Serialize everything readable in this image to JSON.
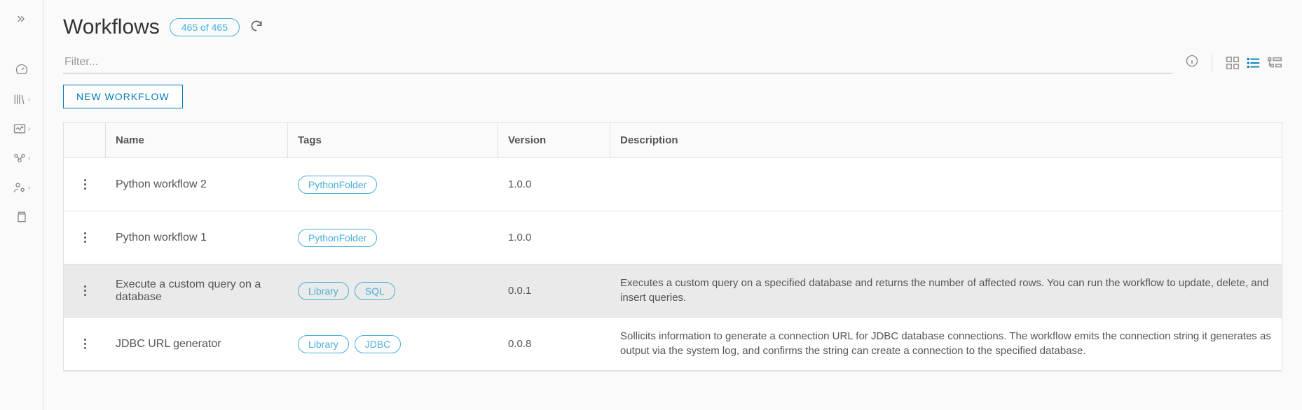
{
  "header": {
    "title": "Workflows",
    "count_badge": "465 of 465"
  },
  "filter": {
    "placeholder": "Filter..."
  },
  "actions": {
    "new_workflow_label": "NEW WORKFLOW"
  },
  "table": {
    "columns": {
      "name": "Name",
      "tags": "Tags",
      "version": "Version",
      "description": "Description"
    },
    "rows": [
      {
        "name": "Python workflow 2",
        "tags": [
          "PythonFolder"
        ],
        "version": "1.0.0",
        "description": "",
        "selected": false
      },
      {
        "name": "Python workflow 1",
        "tags": [
          "PythonFolder"
        ],
        "version": "1.0.0",
        "description": "",
        "selected": false
      },
      {
        "name": "Execute a custom query on a database",
        "tags": [
          "Library",
          "SQL"
        ],
        "version": "0.0.1",
        "description": "Executes a custom query on a specified database and returns the number of affected rows. You can run the workflow to update, delete, and insert queries.",
        "selected": true
      },
      {
        "name": "JDBC URL generator",
        "tags": [
          "Library",
          "JDBC"
        ],
        "version": "0.0.8",
        "description": "Sollicits information to generate a connection URL for JDBC database connections. The workflow emits the connection string it generates as output via the system log, and confirms the string can create a connection to the specified database.",
        "selected": false
      }
    ]
  }
}
